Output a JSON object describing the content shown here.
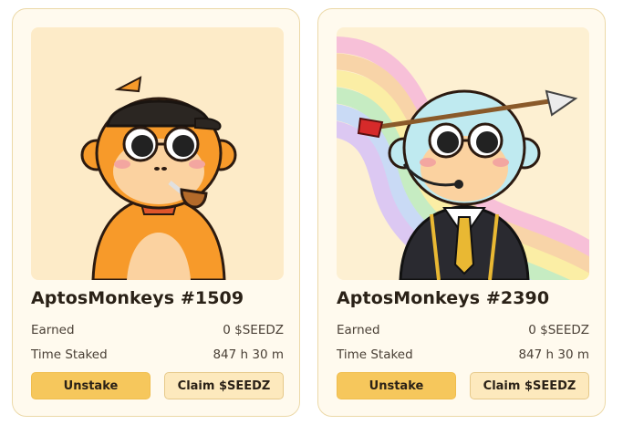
{
  "nfts": [
    {
      "name": "AptosMonkeys #1509",
      "earned_label": "Earned",
      "earned_value": "0 $SEEDZ",
      "staked_label": "Time Staked",
      "staked_value": "847 h 30 m",
      "unstake_label": "Unstake",
      "claim_label": "Claim $SEEDZ"
    },
    {
      "name": "AptosMonkeys #2390",
      "earned_label": "Earned",
      "earned_value": "0 $SEEDZ",
      "staked_label": "Time Staked",
      "staked_value": "847 h 30 m",
      "unstake_label": "Unstake",
      "claim_label": "Claim $SEEDZ"
    }
  ],
  "colors": {
    "card_bg": "#fffaee",
    "card_border": "#ecd9a8",
    "unstake_button": "#f6c75c",
    "claim_button": "#fde9bd",
    "text_dark": "#2a2117"
  }
}
